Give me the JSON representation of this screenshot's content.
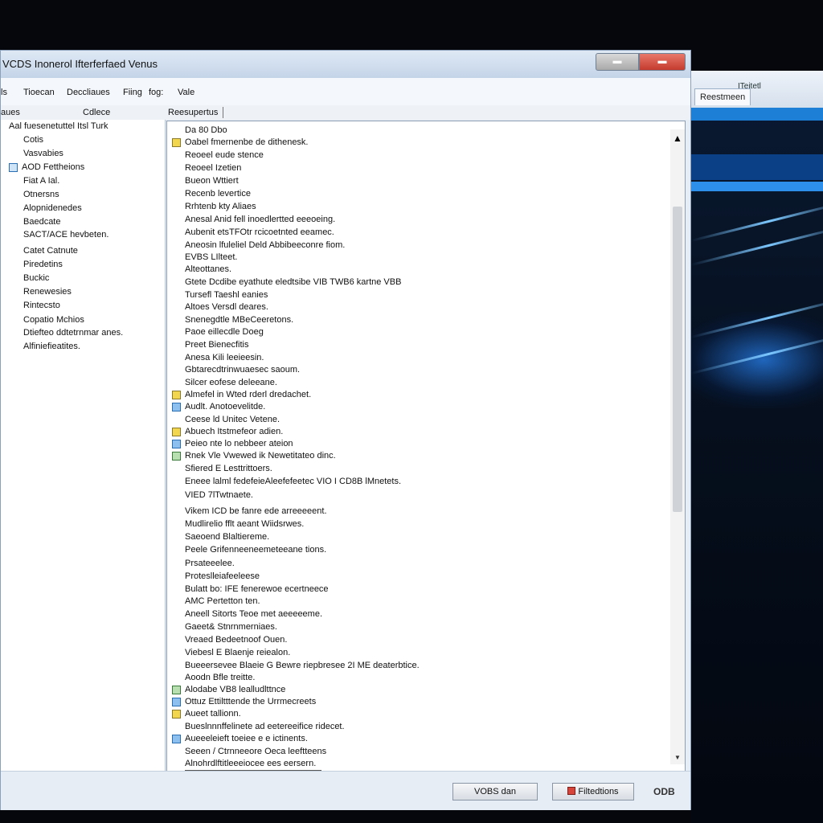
{
  "window": {
    "title": "VCDS Inonerol Ifterferfaed Venus",
    "controls": {
      "minimize": "",
      "close": ""
    }
  },
  "menubar": {
    "items": [
      "ls",
      "Tioecan",
      "Deccliaues",
      "Fiing",
      "fog:",
      "Vale"
    ]
  },
  "columns": {
    "left1": "aues",
    "left2": "Cdlece",
    "right": "Reesupertus"
  },
  "tree": {
    "items": [
      "Aal fuesenetuttel Itsl Turk",
      "Cotis",
      "Vasvabies",
      "AOD Fettheions",
      "Fiat A Ial.",
      "Otnersns",
      "Alopnidenedes",
      "Baedcate",
      "SACT/ACE hevbeten.",
      "Catet Catnute",
      "Piredetins",
      "Buckic",
      "Renewesies",
      "Rintecsto",
      "Copatio Mchios",
      "Dtiefteo ddtetrnmar anes.",
      "Alfiniefieatites."
    ]
  },
  "list": {
    "rows": [
      "Da 80 Dbo",
      "Oabel fmernenbe de dithenesk.",
      "Reoeel eude stence",
      "Reoeel Izetien",
      "Bueon Wttiert",
      "Recenb levertice",
      "Rrhtenb kty Aliaes",
      "Anesal Anid fell inoedlertted eeeoeing.",
      "Aubenit etsTFOtr rcicoetnted eeamec.",
      "Aneosin lfuleliel Deld Abbibeeconre fiom.",
      "EVBS LIlteet.",
      "Alteottanes.",
      "Gtete Dcdibe eyathute eledtsibe VIB TWB6 kartne VBB",
      "Tursefl Taeshl eanies",
      "Altoes Versdl deares.",
      "Snenegdtle MBeCeeretons.",
      "Paoe eillecdle Doeg",
      "Preet Bienecfitis",
      "Anesa Kili leeieesin.",
      "Gbtarecdtrinwuaesec saoum.",
      "Silcer eofese deleeane.",
      "Almefel in Wted rderl dredachet.",
      "Audlt. Anotoevelitde.",
      "Ceese ld Unitec Vetene.",
      "Abuech Itstmefeor adien.",
      "Peieo nte lo nebbeer ateion",
      "Rnek Vle Vwewed ik Newetitateo dinc.",
      "Sfiered E Lesttrittoers.",
      "Eneee lalml fedefeieAleefefeetec VIO I CD8B lMnetets.",
      "VIED 7lTwtnaete.",
      "Vikem ICD be fanre ede arreeeeent.",
      "Mudlirelio fflt aeant Wiidsrwes.",
      "Saeoend Blaltiereme.",
      "Peele Grifenneeneemeteeane tions.",
      "Prsateeelee.",
      "Proteslleiafeeleese",
      "Bulatt bo: IFE fenerewoe ecertneece",
      "AMC Pertetton ten.",
      "Aneell Sitorts Teoe met aeeeeeme.",
      "Gaeet& Stnrnmerniaes.",
      "Vreaed Bedeetnoof Ouen.",
      "Viebesl E Blaenje reiealon.",
      "Bueeersevee Blaeie G Bewre riepbresee 2I ME deaterbtice.",
      "Aoodn Bfle treitte.",
      "Alodabe VB8 lealludlttnce",
      "Ottuz Ettiltttende the Urrmecreets",
      "Aueet tallionn.",
      "Bueslnnnffelinete ad eetereeifice ridecet.",
      "Aueeeleieft toeiee e e ictinents.",
      "Seeen / Ctrnneeore Oeca leeftteens",
      "Alnohrdlftitleeeiocee ees eersern."
    ]
  },
  "bottom": {
    "button1": "VOBS dan",
    "button2": "Filtedtions",
    "status": "ODB"
  },
  "background": {
    "tab": "Reestmeen",
    "tab2": "ITeitetl"
  }
}
